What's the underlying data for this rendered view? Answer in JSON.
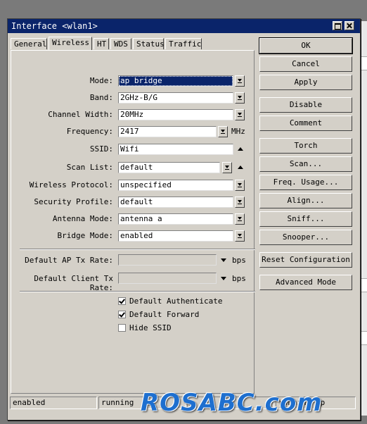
{
  "window": {
    "title": "Interface <wlan1>"
  },
  "tabs": [
    {
      "label": "General"
    },
    {
      "label": "Wireless"
    },
    {
      "label": "HT"
    },
    {
      "label": "WDS"
    },
    {
      "label": "Status"
    },
    {
      "label": "Traffic"
    }
  ],
  "active_tab": "Wireless",
  "form": {
    "mode": {
      "label": "Mode:",
      "value": "ap bridge"
    },
    "band": {
      "label": "Band:",
      "value": "2GHz-B/G"
    },
    "channel_width": {
      "label": "Channel Width:",
      "value": "20MHz"
    },
    "frequency": {
      "label": "Frequency:",
      "value": "2417",
      "unit": "MHz"
    },
    "ssid": {
      "label": "SSID:",
      "value": "Wifi"
    },
    "scan_list": {
      "label": "Scan List:",
      "value": "default"
    },
    "wireless_protocol": {
      "label": "Wireless Protocol:",
      "value": "unspecified"
    },
    "security_profile": {
      "label": "Security Profile:",
      "value": "default"
    },
    "antenna_mode": {
      "label": "Antenna Mode:",
      "value": "antenna a"
    },
    "bridge_mode": {
      "label": "Bridge Mode:",
      "value": "enabled"
    },
    "default_ap_tx_rate": {
      "label": "Default AP Tx Rate:",
      "value": "",
      "unit": "bps"
    },
    "default_client_tx_rate": {
      "label": "Default Client Tx Rate:",
      "value": "",
      "unit": "bps"
    }
  },
  "checkboxes": [
    {
      "label": "Default Authenticate",
      "checked": true
    },
    {
      "label": "Default Forward",
      "checked": true
    },
    {
      "label": "Hide SSID",
      "checked": false
    }
  ],
  "buttons": {
    "ok": "OK",
    "cancel": "Cancel",
    "apply": "Apply",
    "disable": "Disable",
    "comment": "Comment",
    "torch": "Torch",
    "scan": "Scan...",
    "freq_usage": "Freq. Usage...",
    "align": "Align...",
    "sniff": "Sniff...",
    "snooper": "Snooper...",
    "reset_configuration": "Reset Configuration",
    "advanced_mode": "Advanced Mode"
  },
  "statusbar": {
    "state": "enabled",
    "running": "running",
    "running_ap": "running ap"
  },
  "watermark": "ROSABC.com",
  "colors": {
    "titlebar": "#0a246a",
    "face": "#d4d0c8",
    "watermark": "#1e6fcf"
  }
}
